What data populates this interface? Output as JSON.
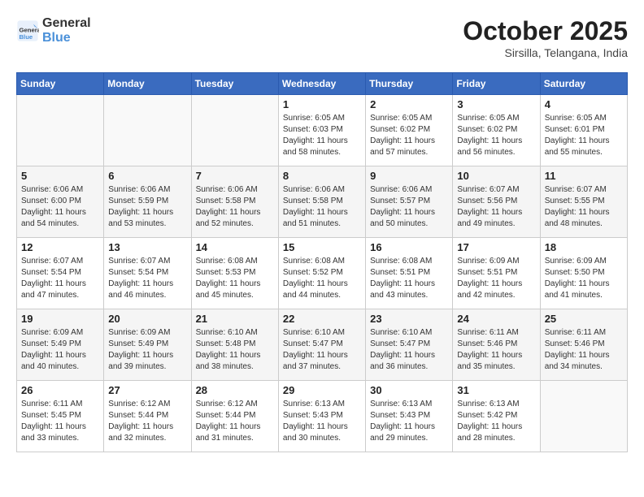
{
  "header": {
    "logo_line1": "General",
    "logo_line2": "Blue",
    "month": "October 2025",
    "location": "Sirsilla, Telangana, India"
  },
  "days_of_week": [
    "Sunday",
    "Monday",
    "Tuesday",
    "Wednesday",
    "Thursday",
    "Friday",
    "Saturday"
  ],
  "weeks": [
    [
      {
        "day": "",
        "info": ""
      },
      {
        "day": "",
        "info": ""
      },
      {
        "day": "",
        "info": ""
      },
      {
        "day": "1",
        "info": "Sunrise: 6:05 AM\nSunset: 6:03 PM\nDaylight: 11 hours and 58 minutes."
      },
      {
        "day": "2",
        "info": "Sunrise: 6:05 AM\nSunset: 6:02 PM\nDaylight: 11 hours and 57 minutes."
      },
      {
        "day": "3",
        "info": "Sunrise: 6:05 AM\nSunset: 6:02 PM\nDaylight: 11 hours and 56 minutes."
      },
      {
        "day": "4",
        "info": "Sunrise: 6:05 AM\nSunset: 6:01 PM\nDaylight: 11 hours and 55 minutes."
      }
    ],
    [
      {
        "day": "5",
        "info": "Sunrise: 6:06 AM\nSunset: 6:00 PM\nDaylight: 11 hours and 54 minutes."
      },
      {
        "day": "6",
        "info": "Sunrise: 6:06 AM\nSunset: 5:59 PM\nDaylight: 11 hours and 53 minutes."
      },
      {
        "day": "7",
        "info": "Sunrise: 6:06 AM\nSunset: 5:58 PM\nDaylight: 11 hours and 52 minutes."
      },
      {
        "day": "8",
        "info": "Sunrise: 6:06 AM\nSunset: 5:58 PM\nDaylight: 11 hours and 51 minutes."
      },
      {
        "day": "9",
        "info": "Sunrise: 6:06 AM\nSunset: 5:57 PM\nDaylight: 11 hours and 50 minutes."
      },
      {
        "day": "10",
        "info": "Sunrise: 6:07 AM\nSunset: 5:56 PM\nDaylight: 11 hours and 49 minutes."
      },
      {
        "day": "11",
        "info": "Sunrise: 6:07 AM\nSunset: 5:55 PM\nDaylight: 11 hours and 48 minutes."
      }
    ],
    [
      {
        "day": "12",
        "info": "Sunrise: 6:07 AM\nSunset: 5:54 PM\nDaylight: 11 hours and 47 minutes."
      },
      {
        "day": "13",
        "info": "Sunrise: 6:07 AM\nSunset: 5:54 PM\nDaylight: 11 hours and 46 minutes."
      },
      {
        "day": "14",
        "info": "Sunrise: 6:08 AM\nSunset: 5:53 PM\nDaylight: 11 hours and 45 minutes."
      },
      {
        "day": "15",
        "info": "Sunrise: 6:08 AM\nSunset: 5:52 PM\nDaylight: 11 hours and 44 minutes."
      },
      {
        "day": "16",
        "info": "Sunrise: 6:08 AM\nSunset: 5:51 PM\nDaylight: 11 hours and 43 minutes."
      },
      {
        "day": "17",
        "info": "Sunrise: 6:09 AM\nSunset: 5:51 PM\nDaylight: 11 hours and 42 minutes."
      },
      {
        "day": "18",
        "info": "Sunrise: 6:09 AM\nSunset: 5:50 PM\nDaylight: 11 hours and 41 minutes."
      }
    ],
    [
      {
        "day": "19",
        "info": "Sunrise: 6:09 AM\nSunset: 5:49 PM\nDaylight: 11 hours and 40 minutes."
      },
      {
        "day": "20",
        "info": "Sunrise: 6:09 AM\nSunset: 5:49 PM\nDaylight: 11 hours and 39 minutes."
      },
      {
        "day": "21",
        "info": "Sunrise: 6:10 AM\nSunset: 5:48 PM\nDaylight: 11 hours and 38 minutes."
      },
      {
        "day": "22",
        "info": "Sunrise: 6:10 AM\nSunset: 5:47 PM\nDaylight: 11 hours and 37 minutes."
      },
      {
        "day": "23",
        "info": "Sunrise: 6:10 AM\nSunset: 5:47 PM\nDaylight: 11 hours and 36 minutes."
      },
      {
        "day": "24",
        "info": "Sunrise: 6:11 AM\nSunset: 5:46 PM\nDaylight: 11 hours and 35 minutes."
      },
      {
        "day": "25",
        "info": "Sunrise: 6:11 AM\nSunset: 5:46 PM\nDaylight: 11 hours and 34 minutes."
      }
    ],
    [
      {
        "day": "26",
        "info": "Sunrise: 6:11 AM\nSunset: 5:45 PM\nDaylight: 11 hours and 33 minutes."
      },
      {
        "day": "27",
        "info": "Sunrise: 6:12 AM\nSunset: 5:44 PM\nDaylight: 11 hours and 32 minutes."
      },
      {
        "day": "28",
        "info": "Sunrise: 6:12 AM\nSunset: 5:44 PM\nDaylight: 11 hours and 31 minutes."
      },
      {
        "day": "29",
        "info": "Sunrise: 6:13 AM\nSunset: 5:43 PM\nDaylight: 11 hours and 30 minutes."
      },
      {
        "day": "30",
        "info": "Sunrise: 6:13 AM\nSunset: 5:43 PM\nDaylight: 11 hours and 29 minutes."
      },
      {
        "day": "31",
        "info": "Sunrise: 6:13 AM\nSunset: 5:42 PM\nDaylight: 11 hours and 28 minutes."
      },
      {
        "day": "",
        "info": ""
      }
    ]
  ]
}
